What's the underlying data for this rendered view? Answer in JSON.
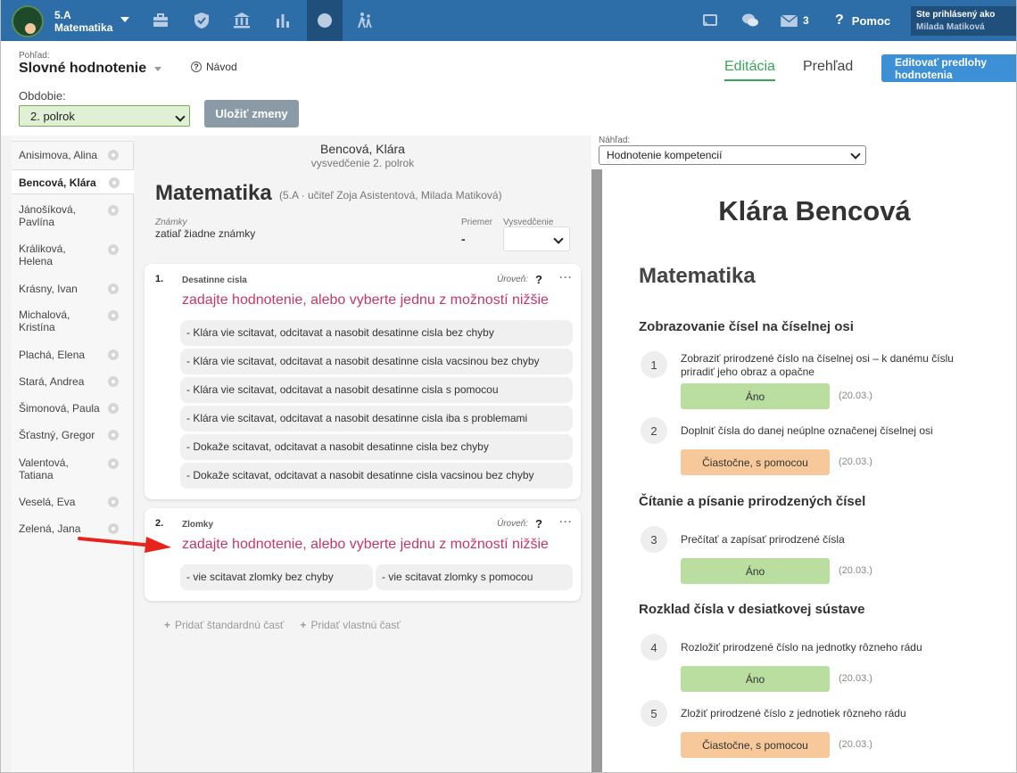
{
  "topbar": {
    "class_name": "5.A",
    "subject": "Matematika",
    "messages_count": "3",
    "help": "Pomoc",
    "logged_as": "Ste prihlásený ako",
    "user": "Milada Matiková"
  },
  "header": {
    "view_label": "Pohľad:",
    "view_title": "Slovné hodnotenie",
    "guide": "Návod",
    "tab_edit": "Editácia",
    "tab_overview": "Prehľad",
    "edit_templates": "Editovať predlohy hodnotenia",
    "period_label": "Obdobie:",
    "period_value": "2. polrok",
    "save_button": "Uložiť zmeny"
  },
  "students": [
    "Anisimova, Alina",
    "Bencová, Klára",
    "Jánošíková, Pavlína",
    "Králiková, Helena",
    "Krásny, Ivan",
    "Michalová, Kristína",
    "Plachá, Elena",
    "Stará, Andrea",
    "Šimonová, Paula",
    "Šťastný, Gregor",
    "Valentová, Tatiana",
    "Veselá, Eva",
    "Zelená, Jana"
  ],
  "editor": {
    "student": "Bencová, Klára",
    "certificate": "vysvedčenie 2. polrok",
    "subject": "Matematika",
    "subject_info": "(5.A · učiteľ Zoja Asistentová, Milada Matiková)",
    "grades_label": "Známky",
    "grades_text": "zatiaľ žiadne známky",
    "average_label": "Priemer",
    "average_value": "-",
    "certificate_label": "Vysvedčenie",
    "level_label": "Úroveň:",
    "level_value": "?",
    "prompt": "zadajte hodnotenie, alebo vyberte jednu z možností nižšie",
    "sections": [
      {
        "num": "1.",
        "title": "Desatinne cisla",
        "options": [
          "-  Klára vie scitavat, odcitavat a nasobit desatinne cisla bez chyby",
          "-  Klára vie scitavat, odcitavat a nasobit desatinne cisla vacsinou bez chyby",
          "-  Klára vie scitavat, odcitavat a nasobit desatinne cisla s pomocou",
          "-  Klára vie scitavat, odcitavat a nasobit desatinne cisla iba s problemami",
          "-  Dokaže scitavat, odcitavat a nasobit desatinne cisla bez chyby",
          "-  Dokaže scitavat, odcitavat a nasobit desatinne cisla vacsinou bez chyby"
        ]
      },
      {
        "num": "2.",
        "title": "Zlomky",
        "options": [
          "-  vie scitavat zlomky bez chyby",
          "-  vie scitavat zlomky s pomocou"
        ]
      }
    ],
    "add_standard": "Pridať štandardnú časť",
    "add_custom": "Pridať vlastnú časť"
  },
  "preview": {
    "label": "Náhľad:",
    "select_value": "Hodnotenie kompetencií",
    "student_name": "Klára Bencová",
    "subject": "Matematika",
    "sections": [
      {
        "title": "Zobrazovanie čísel na číselnej osi"
      },
      {
        "title": "Čítanie a písanie prirodzených čísel"
      },
      {
        "title": "Rozklad čísla v desiatkovej sústave"
      }
    ],
    "items": [
      {
        "num": "1",
        "text": "Zobraziť prirodzené číslo na číselnej osi – k danému číslu priradiť jeho obraz a opačne",
        "rating": "Áno",
        "kind": "yes",
        "date": "(20.03.)"
      },
      {
        "num": "2",
        "text": "Doplniť čísla do danej neúplne označenej číselnej osi",
        "rating": "Čiastočne, s pomocou",
        "kind": "part",
        "date": "(20.03.)"
      },
      {
        "num": "3",
        "text": "Prečítať a zapísať prirodzené čísla",
        "rating": "Áno",
        "kind": "yes",
        "date": "(20.03.)"
      },
      {
        "num": "4",
        "text": "Rozložiť prirodzené číslo na jednotky rôzneho rádu",
        "rating": "Áno",
        "kind": "yes",
        "date": "(20.03.)"
      },
      {
        "num": "5",
        "text": "Zložiť prirodzené číslo z jednotiek rôzneho rádu",
        "rating": "Čiastočne, s pomocou",
        "kind": "part",
        "date": "(20.03.)"
      }
    ]
  },
  "colors": {
    "topbar": "#2d6da8",
    "accent_green": "#3aa55a",
    "prompt_pink": "#c7366a",
    "yes_badge": "#b9dea0",
    "partial_badge": "#f7c99a",
    "annotation_arrow": "#e8221c"
  }
}
